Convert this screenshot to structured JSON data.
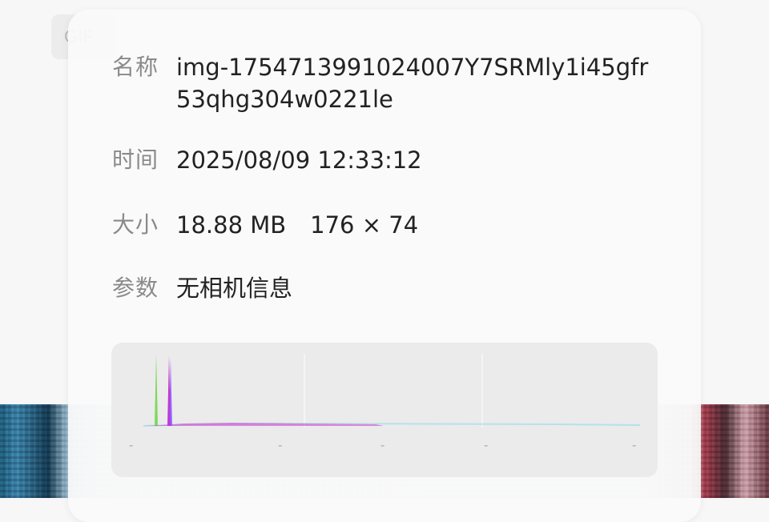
{
  "background": {
    "gif_badge": "GIF"
  },
  "info": {
    "name": {
      "label": "名称",
      "value": "img-1754713991024007Y7SRMly1i45gfr53qhg304w0221le"
    },
    "time": {
      "label": "时间",
      "value": "2025/08/09 12:33:12"
    },
    "size": {
      "label": "大小",
      "file_size": "18.88 MB",
      "dimensions": "176 × 74"
    },
    "params": {
      "label": "参数",
      "value": "无相机信息"
    }
  },
  "histogram": {
    "tick_labels": [
      "-",
      "-",
      "-",
      "-",
      "-"
    ],
    "colors": {
      "green": "#7ed957",
      "magenta": "#cc33cc",
      "purple": "#8a4fff",
      "cyan": "#7ed0e0"
    }
  }
}
